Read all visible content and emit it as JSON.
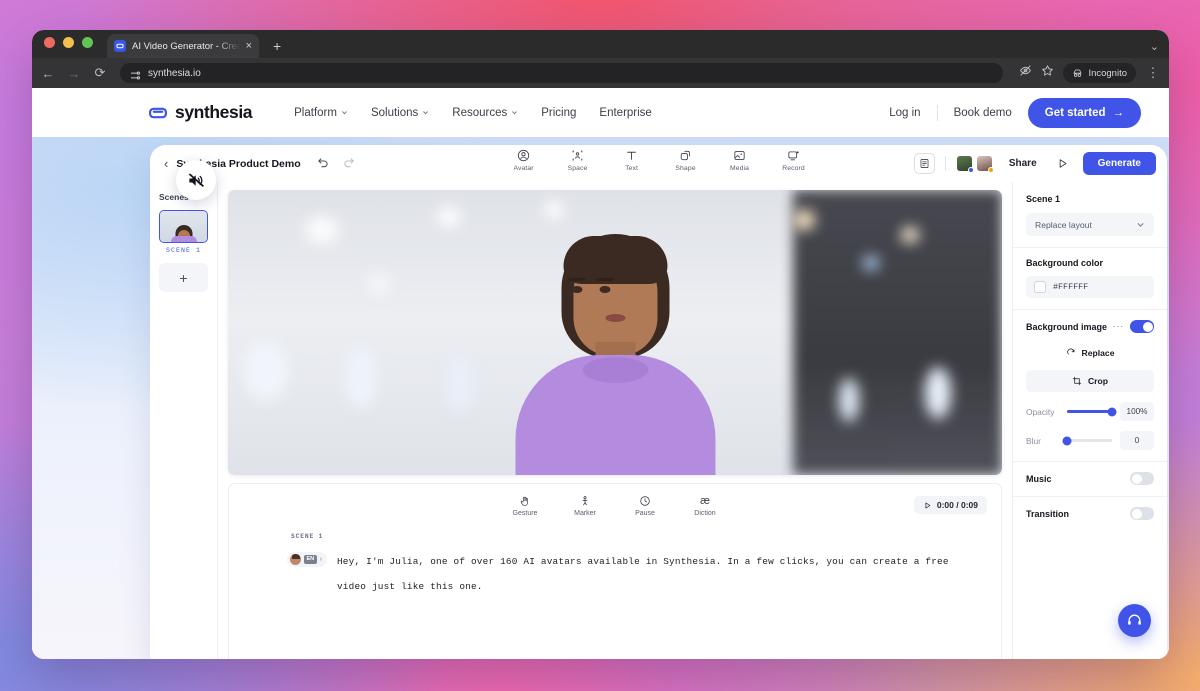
{
  "browser": {
    "tab": {
      "title": "AI Video Generator - Create A",
      "favicon": "synthesia-logo-icon",
      "close": "×"
    },
    "new_tab": "+",
    "nav": {
      "back": "←",
      "forward": "→",
      "reload": "⟳"
    },
    "omnibox": {
      "url": "synthesia.io",
      "icon": "site-settings-icon"
    },
    "actions": {
      "eye_slash": "eye-slash-icon",
      "star": "star-icon",
      "incognito_label": "Incognito",
      "menu": "⋮"
    },
    "window_caret": "⌄"
  },
  "site": {
    "brand": "synthesia",
    "nav_links": [
      {
        "label": "Platform",
        "has_caret": true
      },
      {
        "label": "Solutions",
        "has_caret": true
      },
      {
        "label": "Resources",
        "has_caret": true
      },
      {
        "label": "Pricing",
        "has_caret": false
      },
      {
        "label": "Enterprise",
        "has_caret": false
      }
    ],
    "login": "Log in",
    "book_demo": "Book demo",
    "get_started": "Get started",
    "get_started_arrow": "→",
    "accent_color": "#4054E8"
  },
  "app": {
    "back": "‹",
    "project_title": "Synthesia Product Demo",
    "undo": "undo-icon",
    "redo": "redo-icon",
    "tools": [
      {
        "label": "Avatar",
        "icon": "avatar-icon"
      },
      {
        "label": "Space",
        "icon": "space-icon"
      },
      {
        "label": "Text",
        "icon": "text-icon"
      },
      {
        "label": "Shape",
        "icon": "shape-icon"
      },
      {
        "label": "Media",
        "icon": "media-icon"
      },
      {
        "label": "Record",
        "icon": "record-icon"
      }
    ],
    "notes_icon": "notes-icon",
    "collaborators": [
      {
        "name": "collaborator-1",
        "status_color": "#3b5bdb"
      },
      {
        "name": "collaborator-2",
        "status_color": "#f0a500"
      }
    ],
    "share": "Share",
    "preview_icon": "play-triangle-icon",
    "generate": "Generate",
    "mute_icon": "speaker-muted-icon"
  },
  "scenes_panel": {
    "title": "Scenes",
    "scenes": [
      {
        "label": "SCENE 1",
        "selected": true
      }
    ],
    "add_label": "+"
  },
  "script": {
    "tools": [
      {
        "label": "Gesture",
        "icon": "gesture-hand-icon"
      },
      {
        "label": "Marker",
        "icon": "marker-pin-icon"
      },
      {
        "label": "Pause",
        "icon": "clock-pause-icon"
      },
      {
        "label": "Diction",
        "icon": "diction-ae-icon"
      }
    ],
    "timecode": "0:00 / 0:09",
    "timecode_icon": "play-triangle-icon",
    "scene_label": "SCENE 1",
    "speaker_chip": {
      "avatar": "julia-avatar-icon",
      "language": "EN",
      "chevron": "›"
    },
    "text": "Hey, I'm Julia, one of over 160 AI avatars available in Synthesia. In a few clicks, you can create a free video just like this one."
  },
  "inspector": {
    "title": "Scene 1",
    "layout_select": {
      "value": "Replace layout",
      "chevron": "⌄"
    },
    "background_color": {
      "label": "Background color",
      "value": "#FFFFFF",
      "swatch": "#FFFFFF"
    },
    "background_image": {
      "label": "Background image",
      "more": "···",
      "enabled": true,
      "replace": "Replace",
      "replace_icon": "refresh-icon",
      "crop": "Crop",
      "crop_icon": "crop-icon"
    },
    "opacity": {
      "label": "Opacity",
      "value": "100%",
      "percent": 100
    },
    "blur": {
      "label": "Blur",
      "value": "0",
      "percent": 0
    },
    "music": {
      "label": "Music",
      "enabled": false
    },
    "transition": {
      "label": "Transition",
      "enabled": false
    }
  },
  "support": {
    "icon": "headset-icon"
  }
}
